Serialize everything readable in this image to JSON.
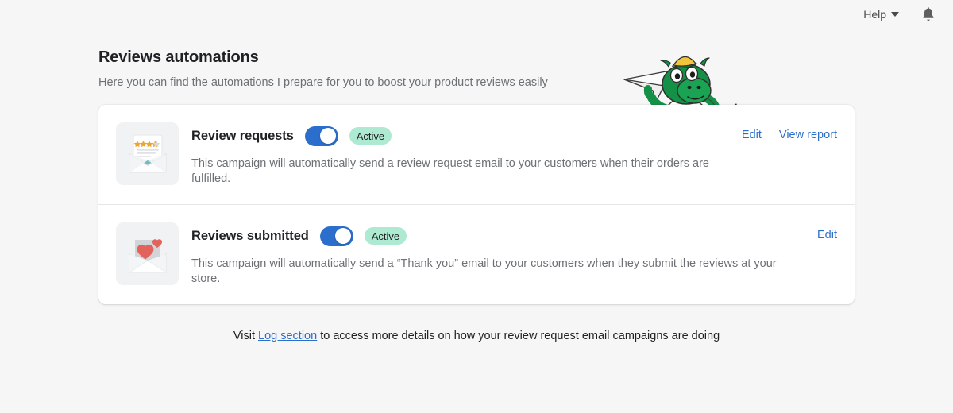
{
  "topbar": {
    "help_label": "Help",
    "help_icon": "chevron-down-icon",
    "notifications_icon": "bell-icon"
  },
  "header": {
    "title": "Reviews automations",
    "subtitle": "Here you can find the automations I prepare for you to boost your product reviews easily",
    "mascot_icon": "dragon-mascot-illustration"
  },
  "automations": [
    {
      "thumbnail_icon": "envelope-review-stars-icon",
      "title": "Review requests",
      "toggle_on": true,
      "status_label": "Active",
      "description": "This campaign will automatically send a review request email to your customers when their orders are fulfilled.",
      "actions": [
        {
          "label": "Edit",
          "name": "edit-link"
        },
        {
          "label": "View report",
          "name": "view-report-link"
        }
      ]
    },
    {
      "thumbnail_icon": "envelope-hearts-icon",
      "title": "Reviews submitted",
      "toggle_on": true,
      "status_label": "Active",
      "description": "This campaign will automatically send a “Thank you” email to your customers when they submit the reviews at your store.",
      "actions": [
        {
          "label": "Edit",
          "name": "edit-link"
        }
      ]
    }
  ],
  "footer": {
    "prefix": "Visit ",
    "link_label": "Log section",
    "suffix": " to access more details on how your review request email campaigns are doing"
  },
  "colors": {
    "page_background": "#f6f6f7",
    "card_background": "#ffffff",
    "accent_blue": "#2c6ecb",
    "badge_green": "#aee9d1",
    "text_primary": "#202223",
    "text_subdued": "#6d7175",
    "divider": "#e6e6e7"
  }
}
